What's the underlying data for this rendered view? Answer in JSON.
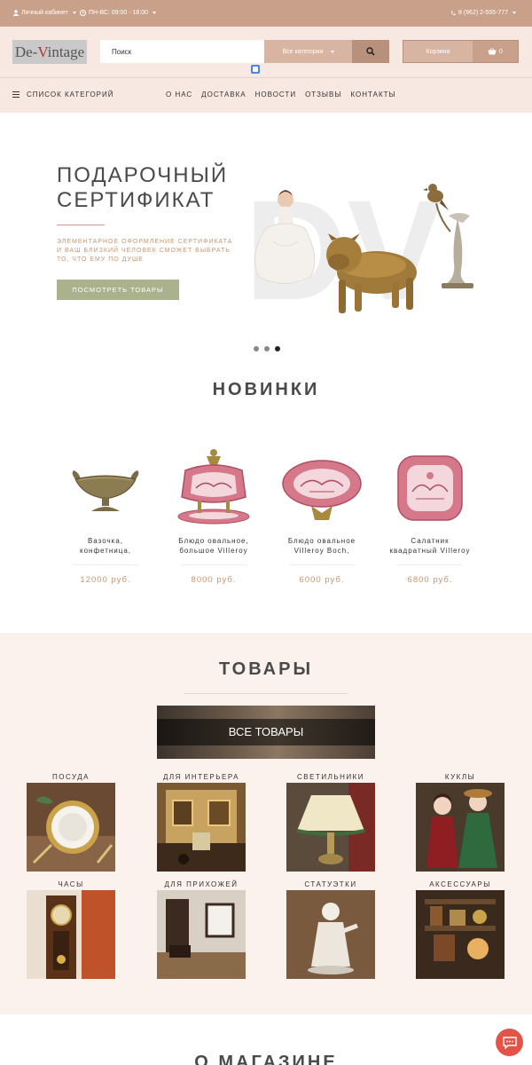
{
  "topbar": {
    "account": "Личный кабинет",
    "hours": "ПН-ВС: 09:00 - 18:00",
    "phone": "8 (962) 2-555-777"
  },
  "header": {
    "logo_prefix": "De-",
    "logo_v": "V",
    "logo_suffix": "intage",
    "search_placeholder": "Поиск",
    "category_select": "Все категории",
    "cart_label": "Корзина",
    "cart_count": "0"
  },
  "menu": {
    "categories_label": "СПИСОК КАТЕГОРИЙ",
    "links": [
      "О НАС",
      "ДОСТАВКА",
      "НОВОСТИ",
      "ОТЗЫВЫ",
      "КОНТАКТЫ"
    ]
  },
  "hero": {
    "title_line1": "ПОДАРОЧНЫЙ",
    "title_line2": "СЕРТИФИКАТ",
    "subtitle": "ЭЛЕМЕНТАРНОЕ ОФОРМЛЕНИЕ СЕРТИФИКАТА И ВАШ БЛИЗКИЙ ЧЕЛОВЕК СМОЖЕТ ВЫБРАТЬ ТО, ЧТО ЕМУ ПО ДУШЕ",
    "button": "ПОСМОТРЕТЬ ТОВАРЫ",
    "watermark": "DV",
    "slides": 3,
    "active_slide": 3
  },
  "new_items": {
    "title": "НОВИНКИ",
    "products": [
      {
        "name_line1": "Вазочка,",
        "name_line2": "конфетница,",
        "price": "12000 руб."
      },
      {
        "name_line1": "Блюдо овальное,",
        "name_line2": "большое Villeroy",
        "price": "8000 руб."
      },
      {
        "name_line1": "Блюдо овальное",
        "name_line2": "Villeroy Boch,",
        "price": "6000 руб."
      },
      {
        "name_line1": "Салатник",
        "name_line2": "квадратный Villeroy",
        "price": "6800 руб."
      }
    ]
  },
  "goods": {
    "title": "ТОВАРЫ",
    "all_goods": "ВСЕ ТОВАРЫ",
    "categories": [
      "ПОСУДА",
      "ДЛЯ ИНТЕРЬЕРА",
      "СВЕТИЛЬНИКИ",
      "КУКЛЫ",
      "ЧАСЫ",
      "ДЛЯ ПРИХОЖЕЙ",
      "СТАТУЭТКИ",
      "АКСЕССУАРЫ"
    ]
  },
  "about": {
    "title": "О МАГАЗИНЕ"
  },
  "colors": {
    "topbar": "#c9a08a",
    "header_bg": "#f8e8e2",
    "accent_text": "#c9946e",
    "hero_button": "#a9b28c",
    "goods_bg": "#fbf2ee",
    "chat": "#e25448"
  }
}
